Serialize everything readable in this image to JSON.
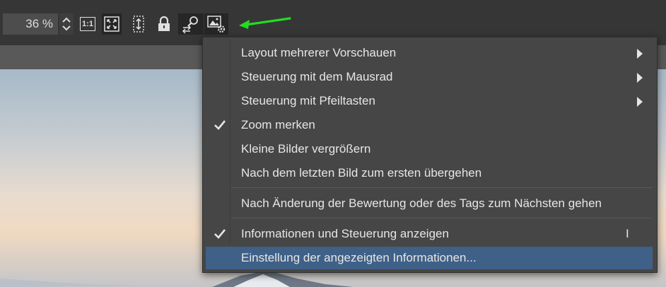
{
  "toolbar": {
    "zoom_value": "36 %",
    "one_to_one_label": "1:1",
    "icons": [
      "spin-up-icon",
      "spin-down-icon",
      "actual-size-icon",
      "fit-to-window-icon",
      "fit-height-icon",
      "lock-icon",
      "zoom-sync-icon",
      "image-settings-icon"
    ],
    "annotation_arrow_color": "#22dd22"
  },
  "menu": {
    "items": [
      {
        "label": "Layout mehrerer Vorschauen",
        "submenu": true,
        "checked": false
      },
      {
        "label": "Steuerung mit dem Mausrad",
        "submenu": true,
        "checked": false
      },
      {
        "label": "Steuerung mit Pfeiltasten",
        "submenu": true,
        "checked": false
      },
      {
        "label": "Zoom merken",
        "submenu": false,
        "checked": true
      },
      {
        "label": "Kleine Bilder vergrößern",
        "submenu": false,
        "checked": false
      },
      {
        "label": "Nach dem letzten Bild zum ersten übergehen",
        "submenu": false,
        "checked": false
      },
      {
        "label": "Nach Änderung der Bewertung oder des Tags zum Nächsten gehen",
        "submenu": false,
        "checked": false
      },
      {
        "label": "Informationen und Steuerung anzeigen",
        "submenu": false,
        "checked": true,
        "shortcut": "I"
      },
      {
        "label": "Einstellung der angezeigten Informationen...",
        "submenu": false,
        "checked": false,
        "highlighted": true
      }
    ],
    "highlight_color": "#3f6188"
  }
}
